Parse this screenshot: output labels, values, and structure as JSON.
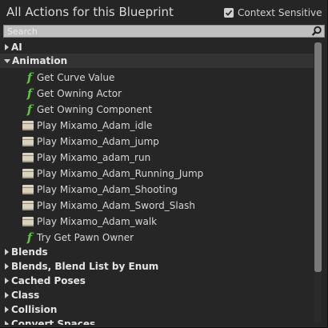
{
  "header": {
    "title": "All Actions for this Blueprint",
    "context_sensitive_label": "Context Sensitive",
    "context_sensitive_checked": true
  },
  "search": {
    "placeholder": "Search",
    "value": ""
  },
  "tree": {
    "categories_top": [
      {
        "label": "AI",
        "expanded": false
      }
    ],
    "animation": {
      "label": "Animation",
      "expanded": true,
      "items": [
        {
          "label": "Get Curve Value",
          "icon": "function-icon"
        },
        {
          "label": "Get Owning Actor",
          "icon": "function-icon"
        },
        {
          "label": "Get Owning Component",
          "icon": "function-icon"
        },
        {
          "label": "Play Mixamo_Adam_idle",
          "icon": "animation-asset-icon"
        },
        {
          "label": "Play Mixamo_Adam_jump",
          "icon": "animation-asset-icon"
        },
        {
          "label": "Play Mixamo_adam_run",
          "icon": "animation-asset-icon"
        },
        {
          "label": "Play Mixamo_Adam_Running_Jump",
          "icon": "animation-asset-icon"
        },
        {
          "label": "Play Mixamo_Adam_Shooting",
          "icon": "animation-asset-icon"
        },
        {
          "label": "Play Mixamo_Adam_Sword_Slash",
          "icon": "animation-asset-icon"
        },
        {
          "label": "Play Mixamo_Adam_walk",
          "icon": "animation-asset-icon"
        },
        {
          "label": "Try Get Pawn Owner",
          "icon": "function-icon"
        }
      ]
    },
    "categories_bottom": [
      {
        "label": "Blends",
        "expanded": false
      },
      {
        "label": "Blends, Blend List by Enum",
        "expanded": false
      },
      {
        "label": "Cached Poses",
        "expanded": false
      },
      {
        "label": "Class",
        "expanded": false
      },
      {
        "label": "Collision",
        "expanded": false
      },
      {
        "label": "Convert Spaces",
        "expanded": false
      }
    ]
  },
  "colors": {
    "background": "#262626",
    "function_icon": "#5bc83b",
    "animation_icon": "#d8d2bf",
    "selected_row": "#333333"
  }
}
